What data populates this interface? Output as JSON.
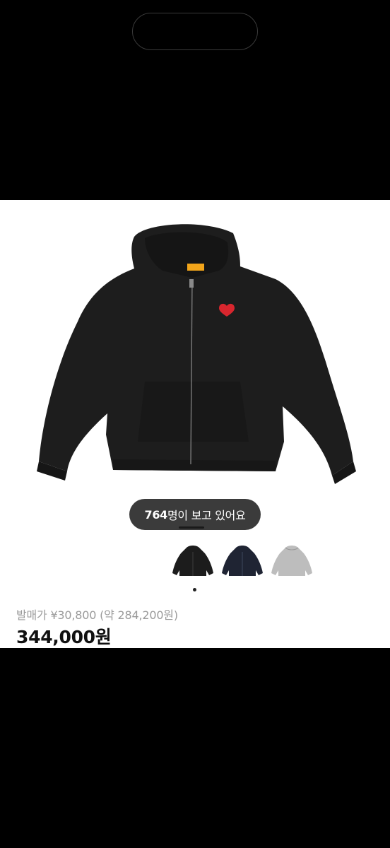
{
  "viewers": {
    "count": "764",
    "suffix": "명이 보고 있어요"
  },
  "product": {
    "release_price": "발매가 ¥30,800 (약 284,200원)",
    "price": "344,000원"
  },
  "thumbnails": [
    {
      "name": "black-hoodie",
      "color": "#1c1c1c"
    },
    {
      "name": "navy-hoodie",
      "color": "#1f2433"
    },
    {
      "name": "gray-hoodie",
      "color": "#bdbdbd"
    }
  ],
  "colors": {
    "hoodie": "#1d1d1d",
    "heart": "#d8262e",
    "tag": "#f2a51a",
    "viewer_pill": "#3b3b3b"
  }
}
